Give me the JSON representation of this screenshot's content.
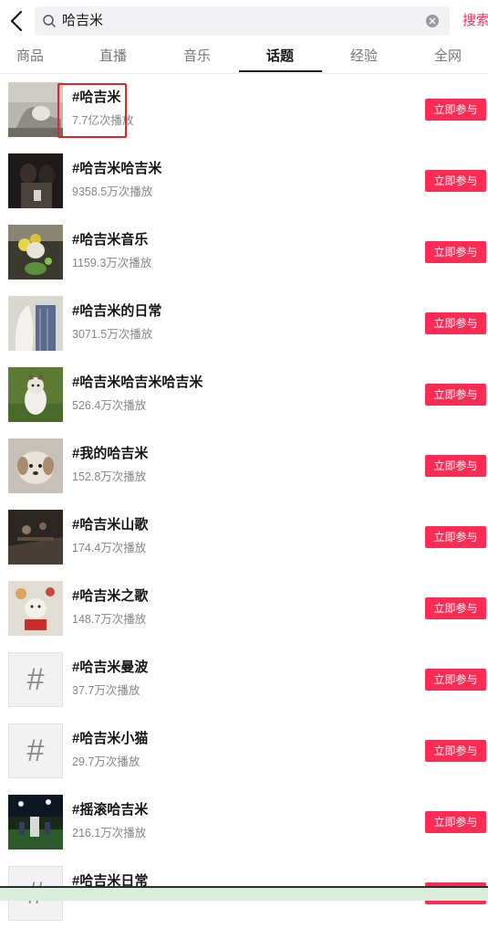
{
  "search": {
    "query": "哈吉米",
    "button_label": "搜索"
  },
  "tabs": [
    {
      "label": "商品",
      "active": false
    },
    {
      "label": "直播",
      "active": false
    },
    {
      "label": "音乐",
      "active": false
    },
    {
      "label": "话题",
      "active": true
    },
    {
      "label": "经验",
      "active": false
    },
    {
      "label": "全网",
      "active": false
    }
  ],
  "join_label": "立即参与",
  "topics": [
    {
      "title": "#哈吉米",
      "plays": "7.7亿次播放",
      "thumb": "photo"
    },
    {
      "title": "#哈吉米哈吉米",
      "plays": "9358.5万次播放",
      "thumb": "photo"
    },
    {
      "title": "#哈吉米音乐",
      "plays": "1159.3万次播放",
      "thumb": "photo"
    },
    {
      "title": "#哈吉米的日常",
      "plays": "3071.5万次播放",
      "thumb": "photo"
    },
    {
      "title": "#哈吉米哈吉米哈吉米",
      "plays": "526.4万次播放",
      "thumb": "photo"
    },
    {
      "title": "#我的哈吉米",
      "plays": "152.8万次播放",
      "thumb": "photo"
    },
    {
      "title": "#哈吉米山歌",
      "plays": "174.4万次播放",
      "thumb": "photo"
    },
    {
      "title": "#哈吉米之歌",
      "plays": "148.7万次播放",
      "thumb": "photo"
    },
    {
      "title": "#哈吉米曼波",
      "plays": "37.7万次播放",
      "thumb": "hash"
    },
    {
      "title": "#哈吉米小猫",
      "plays": "29.7万次播放",
      "thumb": "hash"
    },
    {
      "title": "#摇滚哈吉米",
      "plays": "216.1万次播放",
      "thumb": "photo"
    },
    {
      "title": "#哈吉米日常",
      "plays": "",
      "thumb": "hash"
    }
  ],
  "hash_symbol": "#",
  "colors": {
    "accent": "#fe2c55",
    "highlight_box": "#e32424"
  }
}
